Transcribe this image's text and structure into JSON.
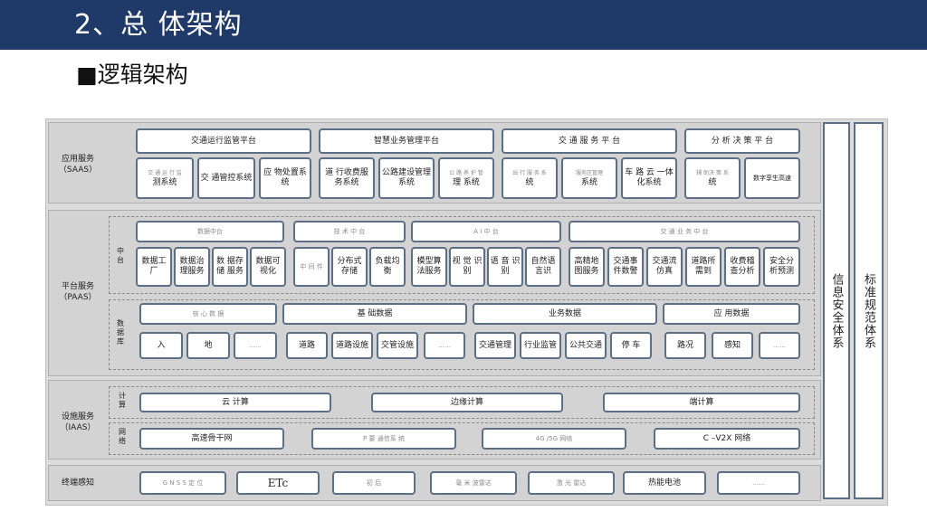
{
  "header": {
    "title": "2、总 体架构"
  },
  "subtitle": "■逻辑架构",
  "side": {
    "info_security": "信息安全体系",
    "standards": "标准规范体系"
  },
  "app_layer": {
    "label": "应用服务（SAAS）",
    "platforms": [
      "交通运行监管平台",
      "智慧业务管理平台",
      "交 通 服 务 平 台",
      "分 析 决 策 平 台"
    ],
    "systems": [
      {
        "pre": "交 通 运 行 监",
        "main": "测系统"
      },
      {
        "pre": "",
        "main": "交 通管控系统"
      },
      {
        "pre": "",
        "main": "应 物处置系统"
      },
      {
        "pre": "",
        "main": "道 行收费服务系统"
      },
      {
        "pre": "",
        "main": "公路建设管理系统"
      },
      {
        "pre": "公 路 养 护 管",
        "main": "理 系统"
      },
      {
        "pre": "出 行 服 务 系",
        "main": "统"
      },
      {
        "pre": "服务区管理",
        "main": "系统"
      },
      {
        "pre": "",
        "main": "车 路 云 一体化系统"
      },
      {
        "pre": "辅 助决 策 系",
        "main": "统"
      },
      {
        "pre": "",
        "main": "数字孪生高速"
      }
    ]
  },
  "platform_layer": {
    "label": "平台服务（PAAS）",
    "middle_label": "中台",
    "db_label": "数据库",
    "groups": [
      "数据中台",
      "技 术 中 台",
      "A I 中 台",
      "交 通 业 务 中 台"
    ],
    "data_mid": [
      "数据工厂",
      "数据治理服务",
      "数 据存储 服务",
      "数据可视化"
    ],
    "tech_mid": [
      "中 间 件",
      "分布式存储",
      "负载均衡"
    ],
    "ai_mid": [
      "模型算法服务",
      "视 觉 识别",
      "语 音 识别",
      "自然语言识"
    ],
    "biz_mid": [
      "高精地图服务",
      "交通事件数警",
      "交通流仿真",
      "道路所需到",
      "收费稽查分析",
      "安全分析预测"
    ],
    "db_groups": [
      "核 心 数 据",
      "基 础数据",
      "业务数据",
      "应 用数据"
    ],
    "db_items": [
      "入",
      "地",
      "……",
      "道路",
      "道路设施",
      "交管设施",
      "……",
      "交通管理",
      "行业监管",
      "公共交通",
      "停 车",
      "路况",
      "感知",
      "……"
    ]
  },
  "infra_layer": {
    "label": "设施服务（IAAS）",
    "compute_label": "计算",
    "network_label": "网络",
    "compute": [
      "云 计算",
      "边缘计算",
      "端计算"
    ],
    "network": [
      "高速骨干网",
      "P 要 通信系 统",
      "4G /5G 网络",
      "C –V2X 网络"
    ]
  },
  "terminal_layer": {
    "label": "终端感知",
    "items": [
      "G N S S 定 位",
      "ETc",
      "初 后",
      "毫 米 波雷达",
      "激 光 雷达",
      "热能电池",
      "……"
    ]
  }
}
